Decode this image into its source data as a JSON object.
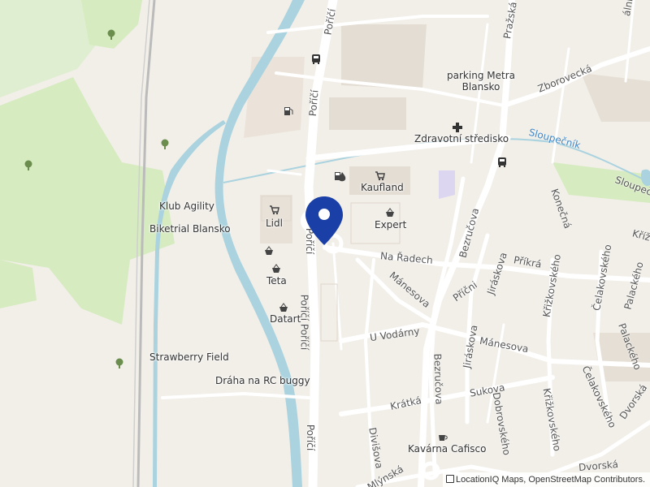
{
  "map": {
    "places": {
      "parking_metra": "parking Metra\nBlansko",
      "zdravotni": "Zdravotní středisko",
      "kaufland": "Kaufland",
      "lidl": "Lidl",
      "expert": "Expert",
      "teta": "Teta",
      "datart": "Datart",
      "klub_agility": "Klub Agility",
      "biketrial": "Biketrial Blansko",
      "strawberry": "Strawberry Field",
      "draha": "Dráha na RC buggy",
      "kavarna": "Kavárna Cafisco"
    },
    "streets": {
      "porici_top": "Poříčí",
      "porici_mid": "Poříčí",
      "porici_mid2": "Poříčí",
      "porici_lower": "Poříčí Poříčí",
      "porici_bottom": "Poříčí",
      "prazska": "Pražská",
      "zborovecka": "Zborovecká",
      "na_radech": "Na Řadech",
      "manesova1": "Mánesova",
      "manesova2": "Mánesova",
      "u_vodarny": "U Vodárny",
      "bezrucova1": "Bezručova",
      "bezrucova2": "Bezručova",
      "jiraskova1": "Jiráskova",
      "jiraskova2": "Jiráskova",
      "pricni": "Příčni",
      "prikra": "Příkrá",
      "konecna": "Konečná",
      "krizkovskeho1": "Křižkovského",
      "krizkovskeho2": "Křižkovského",
      "celakovskeho1": "Čelakovského",
      "celakovskeho2": "Čelakovského",
      "palackeho1": "Palackého",
      "palackeho2": "Palackého",
      "krizova": "Křížo",
      "dvorska1": "Dvorská",
      "dvorska2": "Dvorská",
      "sukova": "Sukova",
      "kratka": "Krátká",
      "dobrovskeho": "Dobrovského",
      "divisova": "Divišova",
      "mlynska": "Mlýnská",
      "top_right": "ální",
      "slouper": "Sloupeč"
    },
    "water": {
      "sloupecnik": "Sloupečník"
    },
    "attribution": "LocationIQ Maps, OpenStreetMap Contributors.",
    "colors": {
      "background": "#f2efe9",
      "park": "#d9ecc5",
      "river": "#aad3df",
      "road": "#ffffff",
      "building": "#e2dcd4",
      "marker": "#1a3fa6"
    }
  }
}
